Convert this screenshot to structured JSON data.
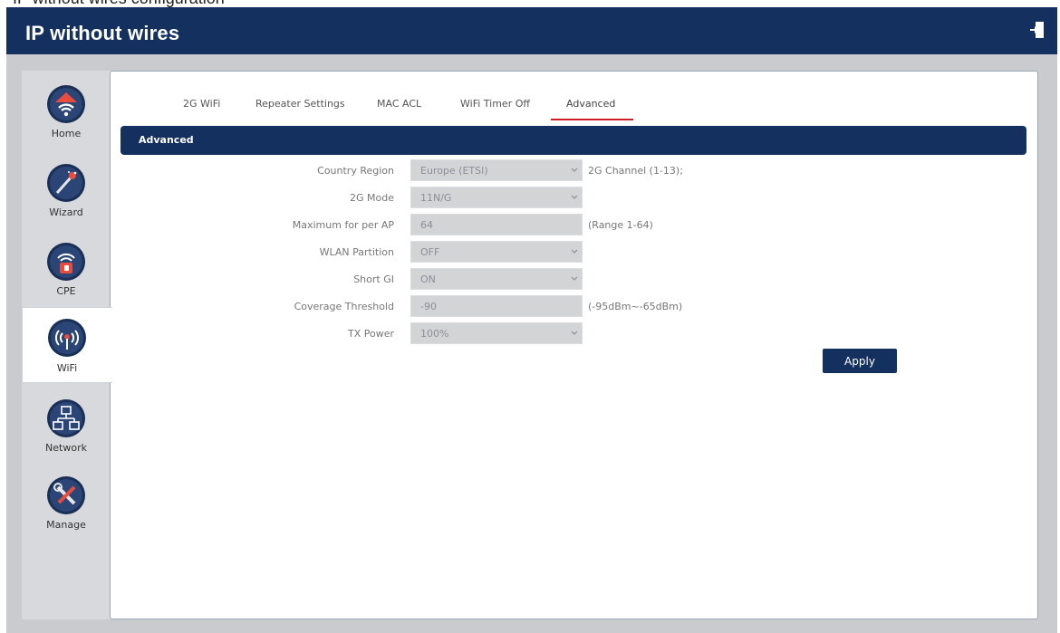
{
  "caption": "IP without wires configuration",
  "app": {
    "title": "IP without wires",
    "logout_icon": "logout-icon"
  },
  "sidebar": {
    "items": [
      {
        "label": "Home",
        "icon": "home-wifi-icon",
        "active": false
      },
      {
        "label": "Wizard",
        "icon": "wizard-wand-icon",
        "active": false
      },
      {
        "label": "CPE",
        "icon": "cpe-antenna-icon",
        "active": false
      },
      {
        "label": "WiFi",
        "icon": "wifi-tower-icon",
        "active": true
      },
      {
        "label": "Network",
        "icon": "network-icon",
        "active": false
      },
      {
        "label": "Manage",
        "icon": "tools-icon",
        "active": false
      }
    ]
  },
  "tabs": [
    {
      "label": "2G WiFi"
    },
    {
      "label": "Repeater Settings"
    },
    {
      "label": "MAC ACL"
    },
    {
      "label": "WiFi Timer Off"
    },
    {
      "label": "Advanced",
      "active": true
    }
  ],
  "section": {
    "title": "Advanced"
  },
  "form": {
    "rows": [
      {
        "label": "Country Region",
        "value": "Europe (ETSI)",
        "type": "select",
        "note": "2G Channel (1-13);"
      },
      {
        "label": "2G Mode",
        "value": "11N/G",
        "type": "select",
        "note": ""
      },
      {
        "label": "Maximum for per AP",
        "value": "64",
        "type": "input",
        "note": "(Range 1-64)"
      },
      {
        "label": "WLAN Partition",
        "value": "OFF",
        "type": "select",
        "note": ""
      },
      {
        "label": "Short GI",
        "value": "ON",
        "type": "select",
        "note": ""
      },
      {
        "label": "Coverage Threshold",
        "value": "-90",
        "type": "input",
        "note": "(-95dBm~-65dBm)"
      },
      {
        "label": "TX Power",
        "value": "100%",
        "type": "select",
        "note": ""
      }
    ],
    "apply_label": "Apply"
  },
  "colors": {
    "header": "#13305f",
    "accent_red": "#d01c26",
    "frame": "#c9cbce"
  }
}
